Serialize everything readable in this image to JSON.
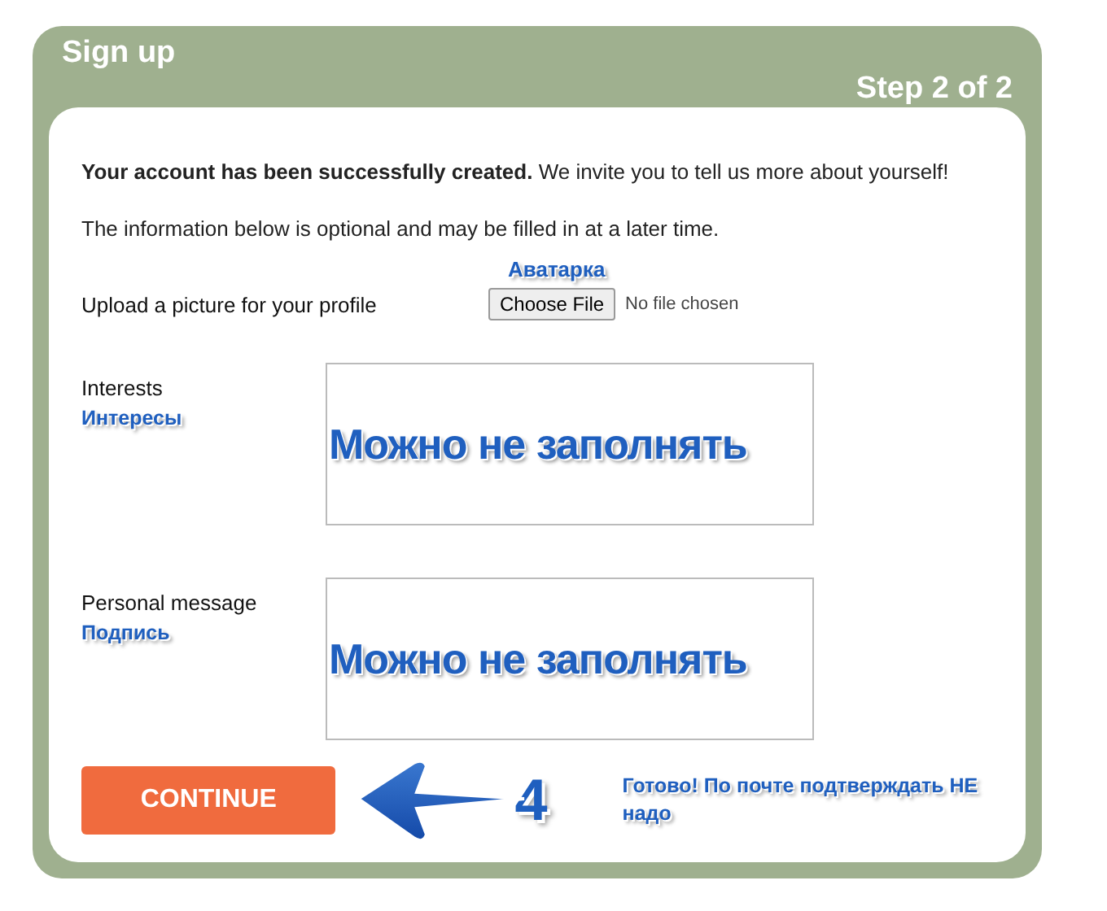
{
  "header": {
    "title": "Sign up",
    "step": "Step 2 of 2"
  },
  "intro": "**Your account has been successfully created.** We invite you to tell us more about yourself!",
  "info": "The information below is optional and may be filled in at a later time.",
  "upload": {
    "note": "Аватарка",
    "label": "Upload a picture for your profile",
    "button": "Choose File",
    "status": "No file chosen"
  },
  "fields": [
    {
      "label": "Interests",
      "note": "Интересы",
      "overlay": "Можно не заполнять"
    },
    {
      "label": "Personal message",
      "note": "Подпись",
      "overlay": "Можно не заполнять"
    }
  ],
  "continue_button": "CONTINUE",
  "callout": {
    "number": "4",
    "note": "Готово! По почте подтверждать НЕ надо"
  }
}
